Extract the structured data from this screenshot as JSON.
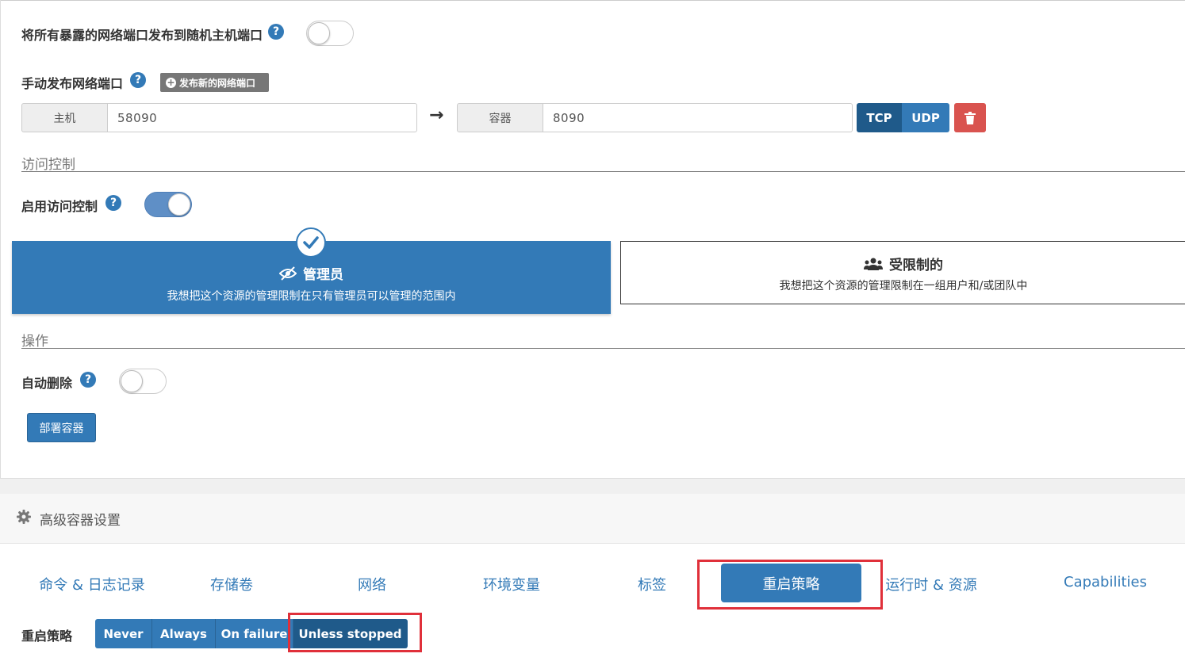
{
  "publish_all": {
    "label": "将所有暴露的网络端口发布到随机主机端口",
    "help": "?",
    "enabled": false
  },
  "manual_publish": {
    "label": "手动发布网络端口",
    "help": "?",
    "add_button": "发布新的网络端口",
    "port": {
      "host_label": "主机",
      "host_value": "58090",
      "arrow": "→",
      "container_label": "容器",
      "container_value": "8090",
      "protocols": [
        "TCP",
        "UDP"
      ],
      "selected_protocol": "TCP"
    }
  },
  "access_control": {
    "section_title": "访问控制",
    "toggle_label": "启用访问控制",
    "help": "?",
    "enabled": true,
    "options": {
      "admin": {
        "title": "管理员",
        "description": "我想把这个资源的管理限制在只有管理员可以管理的范围内",
        "selected": true
      },
      "restricted": {
        "title": "受限制的",
        "description": "我想把这个资源的管理限制在一组用户和/或团队中",
        "selected": false
      }
    }
  },
  "actions": {
    "section_title": "操作",
    "auto_remove_label": "自动删除",
    "help": "?",
    "auto_remove_enabled": false,
    "deploy_button": "部署容器"
  },
  "advanced": {
    "title": "高级容器设置",
    "tabs": [
      "命令 & 日志记录",
      "存储卷",
      "网络",
      "环境变量",
      "标签",
      "重启策略",
      "运行时 & 资源",
      "Capabilities"
    ],
    "active_tab": "重启策略"
  },
  "restart_policy": {
    "label": "重启策略",
    "options": [
      "Never",
      "Always",
      "On failure",
      "Unless stopped"
    ],
    "selected": "Unless stopped"
  },
  "colors": {
    "primary": "#337ab7",
    "primary_dark": "#1f5a8a",
    "danger": "#d9534f",
    "highlight_box": "#e0303a"
  }
}
